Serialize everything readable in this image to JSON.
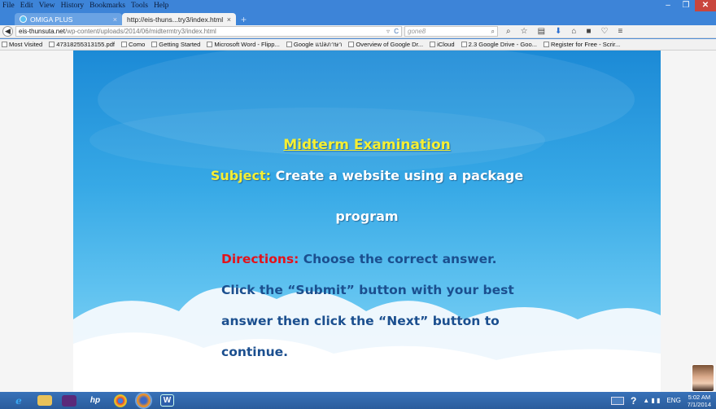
{
  "menu": [
    "File",
    "Edit",
    "View",
    "History",
    "Bookmarks",
    "Tools",
    "Help"
  ],
  "window_controls": {
    "minimize": "–",
    "restore": "❐",
    "close": "✕"
  },
  "tabs": [
    {
      "label": "OMIGA PLUS",
      "close": "×"
    },
    {
      "label": "http://eis-thuns...try3/index.html",
      "close": "×"
    }
  ],
  "new_tab": "+",
  "nav": {
    "back": "◀",
    "url_host": "eis-thunsuta.net",
    "url_path": "/wp-content/uploads/2014/06/midtermtry3/index.html",
    "url_icons": "▿",
    "reload": "C",
    "search_placeholder": "gone8",
    "search_icon": "⌕",
    "toolbar_icons": [
      "⌕",
      "☆",
      "▤",
      "⬇",
      "⌂",
      "■",
      "♡",
      "≡"
    ]
  },
  "bookmarks": [
    "Most Visited",
    "4731825531315​5.pdf",
    "Como",
    "Getting Started",
    "Microsoft Word - Flipp...",
    "Google แปลภาษา",
    "Overview of Google Dr...",
    "iCloud",
    "2.3 Google Drive - Goo...",
    "Register for Free - Scrir..."
  ],
  "exam": {
    "title": "Midterm Examination",
    "subject_label": "Subject:",
    "subject_text_line1": "Create a website using a package",
    "subject_text_line2": "program",
    "directions_label": "Directions:",
    "directions_line1": "Choose the correct answer.",
    "directions_line2": "Click the “Submit” button with your best",
    "directions_line3": "answer then click the “Next” button to",
    "directions_line4": "continue."
  },
  "taskbar": {
    "ie": "e",
    "hp": "hp",
    "word": "W",
    "tray_help": "?",
    "language": "ENG",
    "time": "5:02 AM",
    "date": "7/1/2014"
  },
  "colors": {
    "title_yellow": "#f6ef33",
    "directions_red": "#e3121b",
    "body_blue": "#1b4f8f",
    "sky_top": "#1c8ad6",
    "sky_bottom": "#8fd6f5"
  }
}
